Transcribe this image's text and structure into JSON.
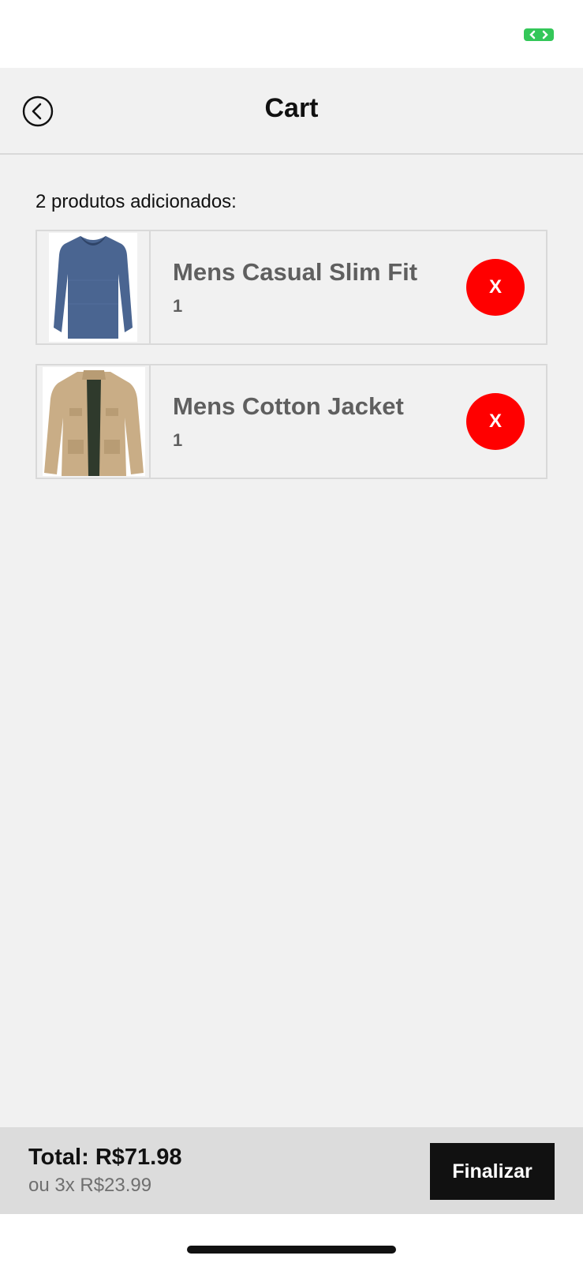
{
  "header": {
    "title": "Cart",
    "back_icon": "chevron-left-circle-icon"
  },
  "cart": {
    "count_label": "2 produtos adicionados:",
    "items": [
      {
        "name": "Mens Casual Slim Fit",
        "quantity": "1",
        "remove_label": "X",
        "image": "blue-long-sleeve-shirt"
      },
      {
        "name": "Mens Cotton Jacket",
        "quantity": "1",
        "remove_label": "X",
        "image": "khaki-cotton-jacket"
      }
    ]
  },
  "footer": {
    "total": "Total: R$71.98",
    "installments": "ou 3x R$23.99",
    "finalize_label": "Finalizar"
  },
  "colors": {
    "background": "#f1f1f1",
    "remove_button": "#ff0000",
    "finalize_button": "#111111",
    "status_indicator": "#34c759"
  }
}
